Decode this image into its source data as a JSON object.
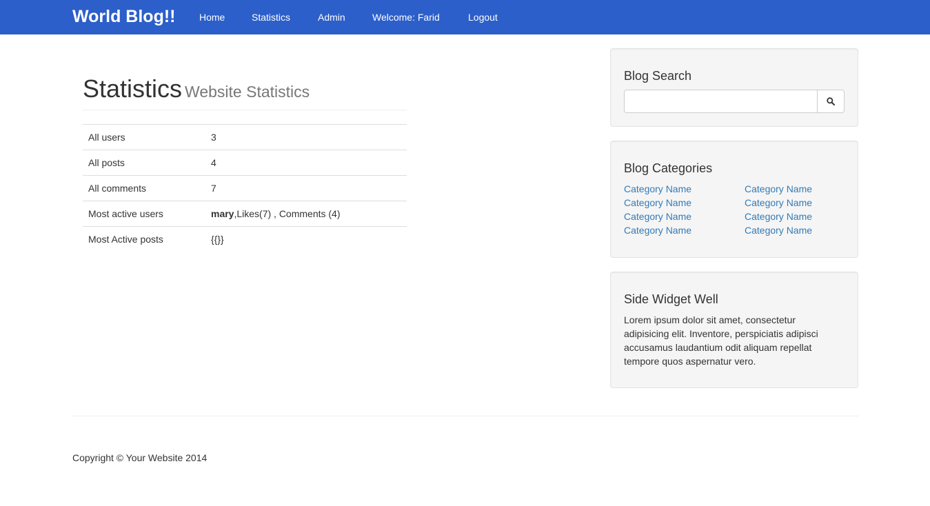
{
  "navbar": {
    "brand": "World Blog!!",
    "links": [
      "Home",
      "Statistics",
      "Admin",
      "Welcome: Farid",
      "Logout"
    ]
  },
  "page_header": {
    "title": "Statistics",
    "subtitle": "Website Statistics"
  },
  "stats": [
    {
      "label": "All users",
      "value": "3"
    },
    {
      "label": "All posts",
      "value": "4"
    },
    {
      "label": "All comments",
      "value": "7"
    },
    {
      "label": "Most active users",
      "value_user": "mary",
      "value_rest": ",Likes(7) , Comments (4)"
    },
    {
      "label": "Most Active posts",
      "value": "{{}}"
    }
  ],
  "sidebar": {
    "search": {
      "title": "Blog Search",
      "input_value": "",
      "button_icon": "search-icon"
    },
    "categories": {
      "title": "Blog Categories",
      "left": [
        "Category Name",
        "Category Name",
        "Category Name",
        "Category Name"
      ],
      "right": [
        "Category Name",
        "Category Name",
        "Category Name",
        "Category Name"
      ]
    },
    "widget": {
      "title": "Side Widget Well",
      "text": "Lorem ipsum dolor sit amet, consectetur adipisicing elit. Inventore, perspiciatis adipisci accusamus laudantium odit aliquam repellat tempore quos aspernatur vero."
    }
  },
  "footer": {
    "copyright": "Copyright © Your Website 2014"
  },
  "colors": {
    "navbar": "#2c5fc9",
    "link": "#337ab7",
    "well": "#f5f5f5"
  }
}
